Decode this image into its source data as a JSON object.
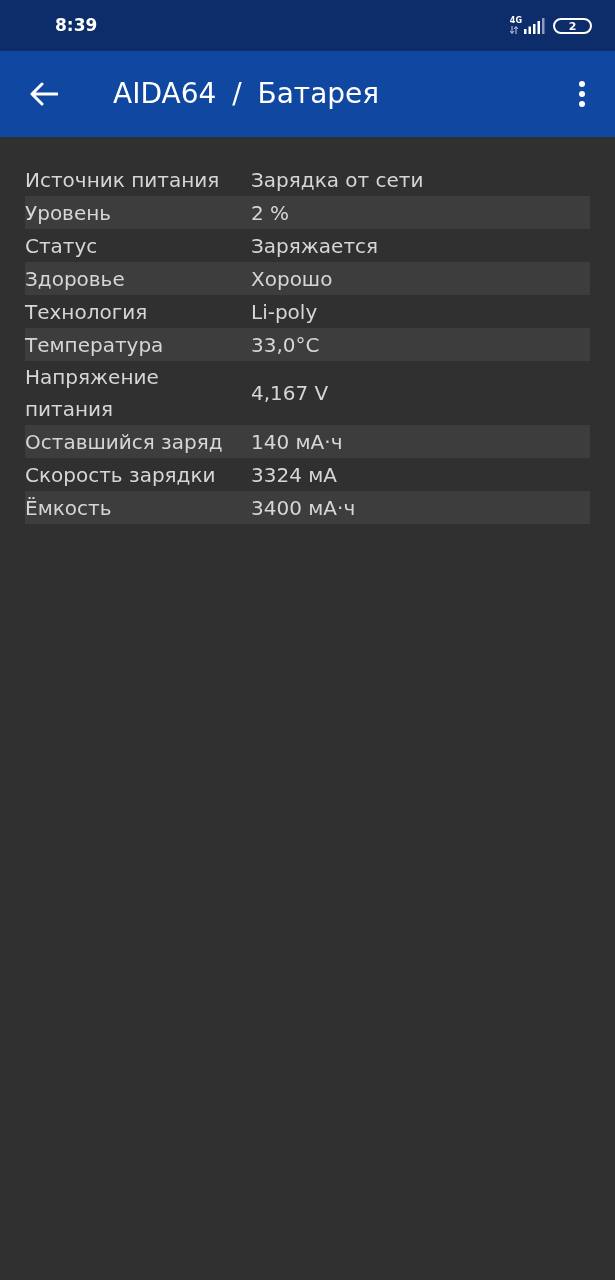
{
  "status_bar": {
    "time": "8:39",
    "network": "4G",
    "battery": "2"
  },
  "app_bar": {
    "title": "AIDA64 / Батарея"
  },
  "rows": [
    {
      "label": "Источник питания",
      "value": "Зарядка от сети"
    },
    {
      "label": "Уровень",
      "value": "2 %"
    },
    {
      "label": "Статус",
      "value": "Заряжается"
    },
    {
      "label": "Здоровье",
      "value": "Хорошо"
    },
    {
      "label": "Технология",
      "value": "Li-poly"
    },
    {
      "label": "Температура",
      "value": "33,0°C"
    },
    {
      "label": "Напряжение питания",
      "value": "4,167 V"
    },
    {
      "label": "Оставшийся заряд",
      "value": "140 мА·ч"
    },
    {
      "label": "Скорость зарядки",
      "value": "3324 мА"
    },
    {
      "label": "Ёмкость",
      "value": "3400 мА·ч"
    }
  ]
}
